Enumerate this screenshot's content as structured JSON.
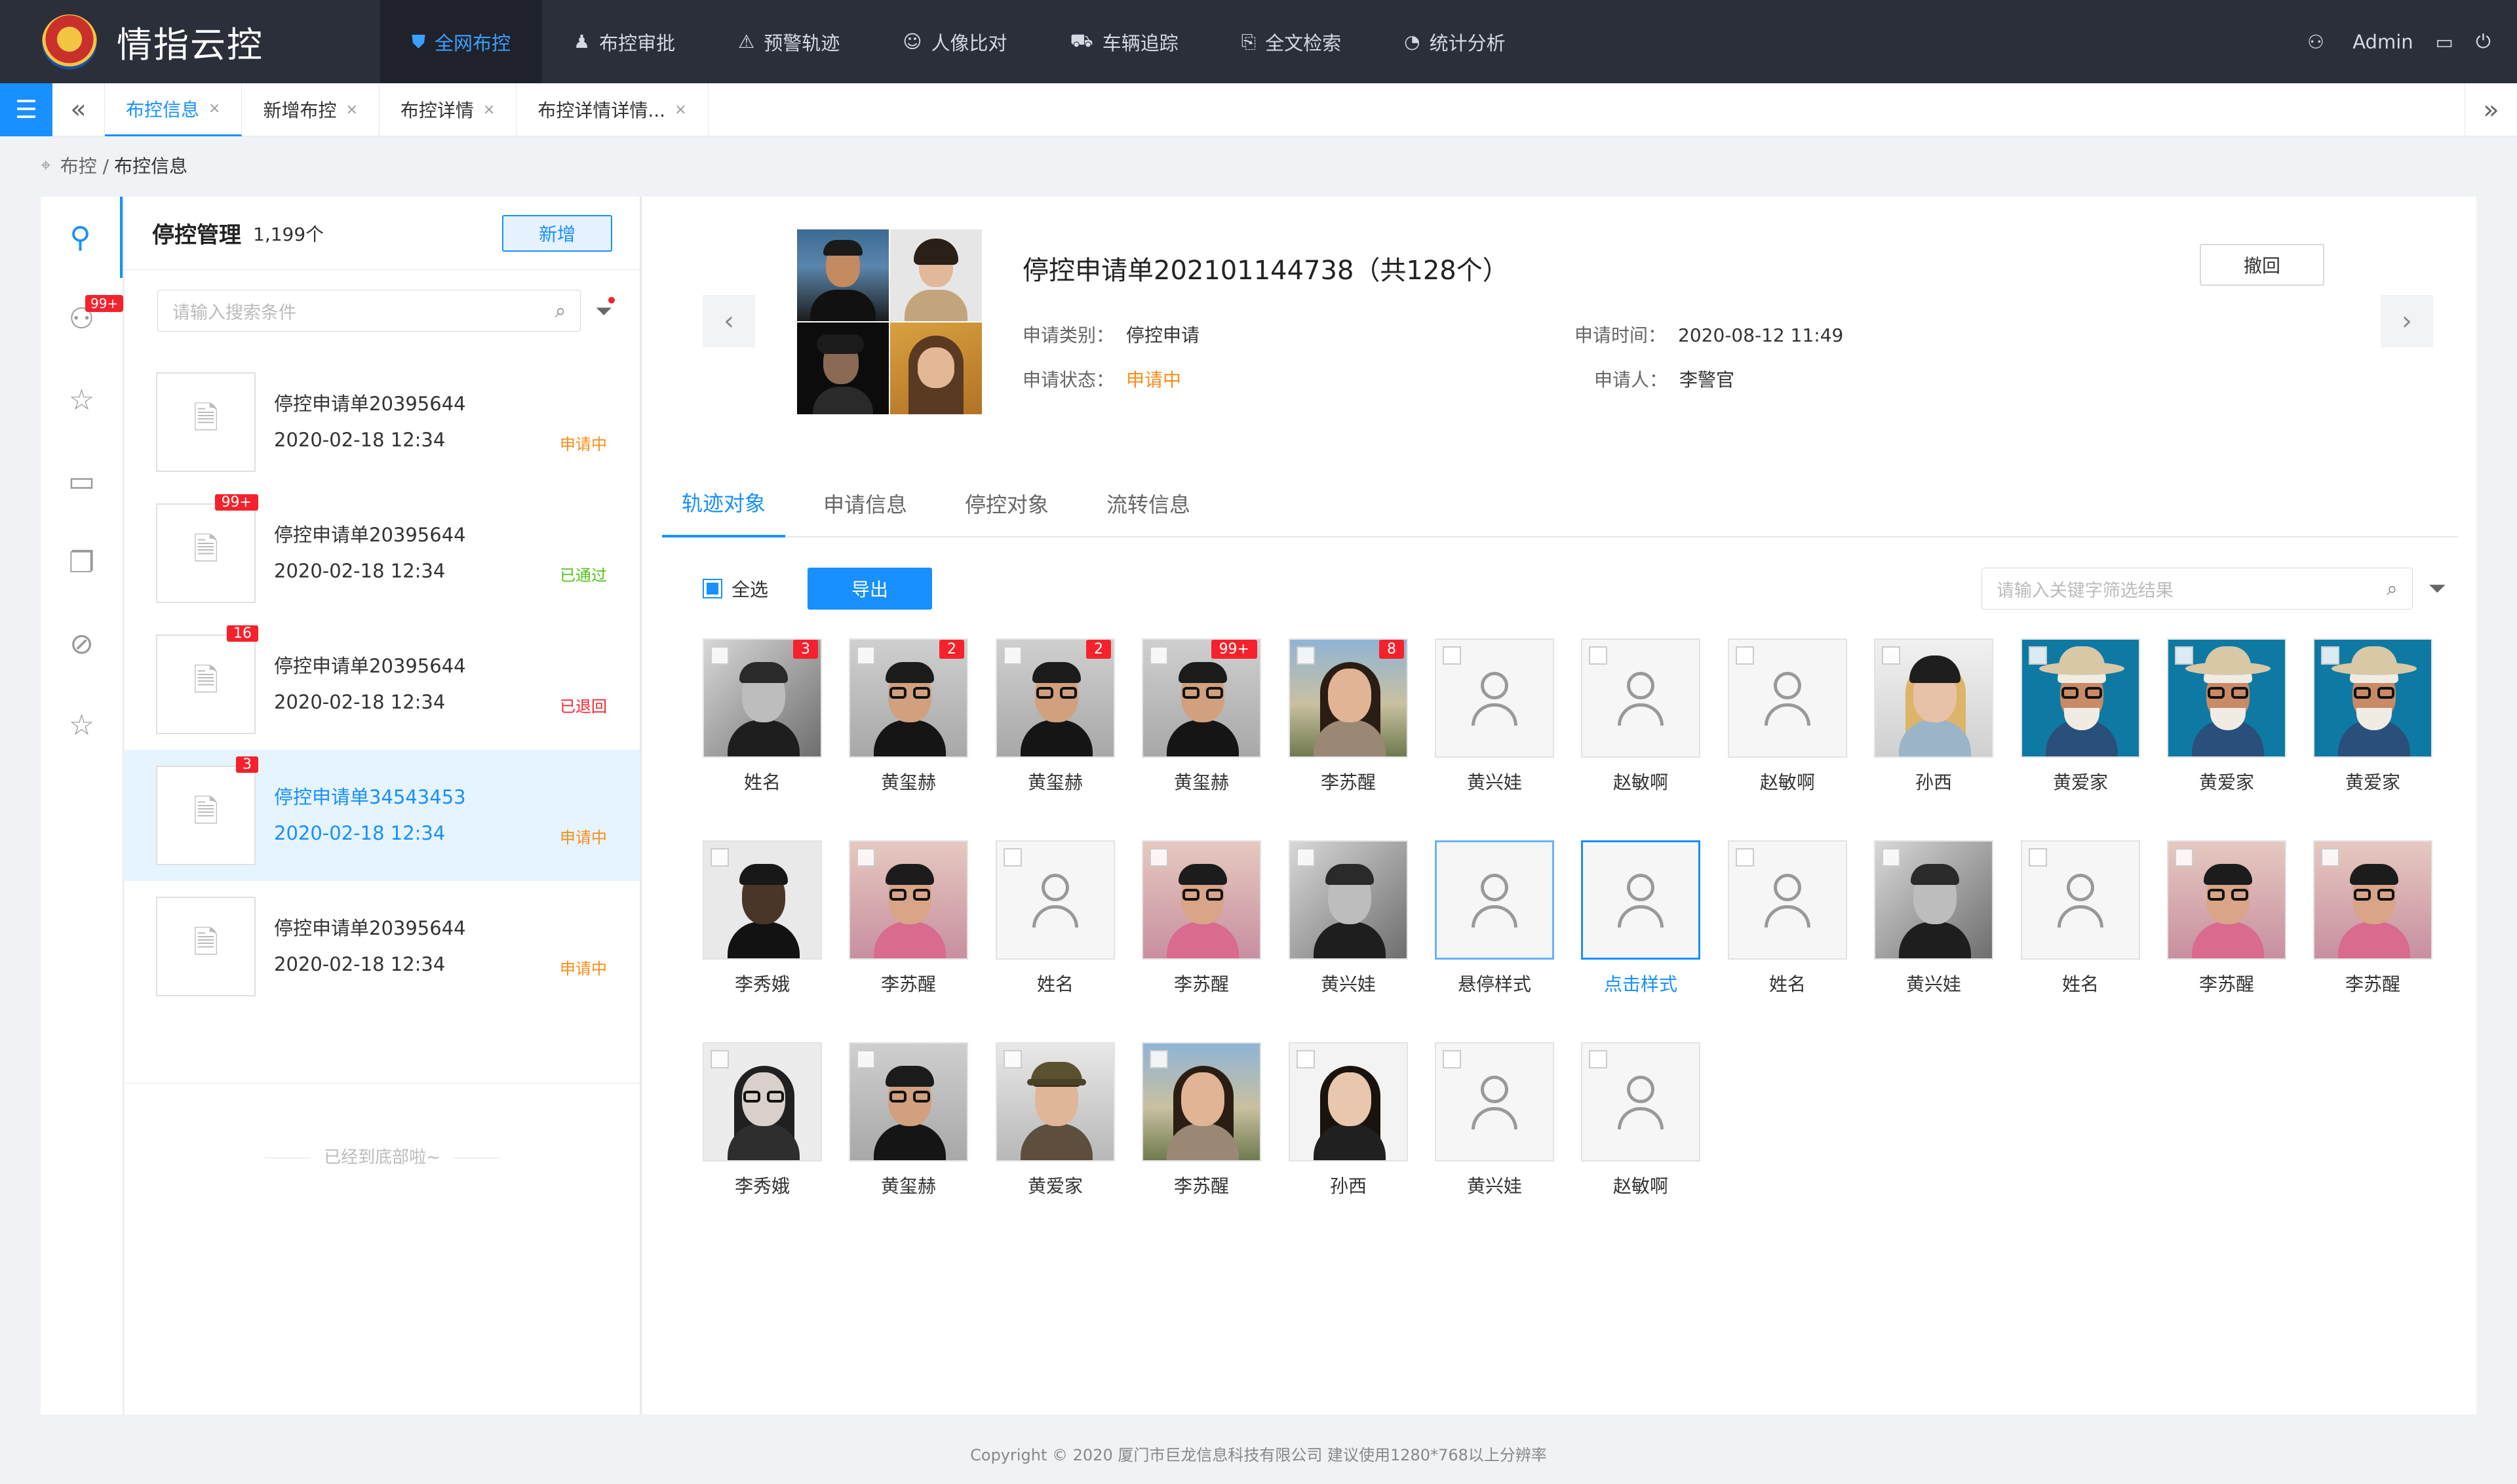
{
  "app": {
    "title": "情指云控"
  },
  "nav": [
    {
      "label": "全网布控",
      "icon": "shield-icon",
      "active": true
    },
    {
      "label": "布控审批",
      "icon": "user-icon",
      "active": false
    },
    {
      "label": "预警轨迹",
      "icon": "alarm-icon",
      "active": false
    },
    {
      "label": "人像比对",
      "icon": "face-icon",
      "active": false
    },
    {
      "label": "车辆追踪",
      "icon": "car-icon",
      "active": false
    },
    {
      "label": "全文检索",
      "icon": "doc-search-icon",
      "active": false
    },
    {
      "label": "统计分析",
      "icon": "pie-icon",
      "active": false
    }
  ],
  "user": {
    "name": "Admin"
  },
  "tabs": [
    {
      "label": "布控信息",
      "active": true
    },
    {
      "label": "新增布控",
      "active": false
    },
    {
      "label": "布控详情",
      "active": false
    },
    {
      "label": "布控详情详情...",
      "active": false
    }
  ],
  "breadcrumb": {
    "parent": "布控 /",
    "current": "布控信息"
  },
  "rail": {
    "badge": "99+"
  },
  "list": {
    "title": "停控管理",
    "count": "1,199个",
    "add_label": "新增",
    "search_placeholder": "请输入搜索条件",
    "end_text": "已经到底部啦~",
    "items": [
      {
        "title": "停控申请单20395644",
        "time": "2020-02-18  12:34",
        "status": "申请中",
        "status_type": "pending",
        "badge": ""
      },
      {
        "title": "停控申请单20395644",
        "time": "2020-02-18  12:34",
        "status": "已通过",
        "status_type": "passed",
        "badge": "99+"
      },
      {
        "title": "停控申请单20395644",
        "time": "2020-02-18  12:34",
        "status": "已退回",
        "status_type": "back",
        "badge": "16"
      },
      {
        "title": "停控申请单34543453",
        "time": "2020-02-18  12:34",
        "status": "申请中",
        "status_type": "pending",
        "badge": "3"
      },
      {
        "title": "停控申请单20395644",
        "time": "2020-02-18  12:34",
        "status": "申请中",
        "status_type": "pending",
        "badge": ""
      }
    ]
  },
  "detail": {
    "title": "停控申请单202101144738（共128个）",
    "type_label": "申请类别：",
    "type_value": "停控申请",
    "status_label": "申请状态：",
    "status_value": "申请中",
    "time_label": "申请时间：",
    "time_value": "2020-08-12   11:49",
    "applicant_label": "申请人：",
    "applicant_value": "李警官",
    "revoke_label": "撤回",
    "tabs": [
      "轨迹对象",
      "申请信息",
      "停控对象",
      "流转信息"
    ],
    "select_all": "全选",
    "export_label": "导出",
    "filter_placeholder": "请输入关键字筛选结果"
  },
  "people": [
    {
      "name": "姓名",
      "photo": "bw-man",
      "badge": "3"
    },
    {
      "name": "黄玺赫",
      "photo": "glasses-man",
      "badge": "2"
    },
    {
      "name": "黄玺赫",
      "photo": "glasses-man",
      "badge": "2"
    },
    {
      "name": "黄玺赫",
      "photo": "glasses-man",
      "badge": "99+"
    },
    {
      "name": "李苏醒",
      "photo": "woman-outdoor",
      "badge": "8"
    },
    {
      "name": "黄兴娃",
      "photo": "",
      "badge": ""
    },
    {
      "name": "赵敏啊",
      "photo": "",
      "badge": ""
    },
    {
      "name": "赵敏啊",
      "photo": "",
      "badge": ""
    },
    {
      "name": "孙西",
      "photo": "beanie-woman",
      "badge": ""
    },
    {
      "name": "黄爱家",
      "photo": "hat-man",
      "badge": ""
    },
    {
      "name": "黄爱家",
      "photo": "hat-man",
      "badge": ""
    },
    {
      "name": "黄爱家",
      "photo": "hat-man",
      "badge": ""
    },
    {
      "name": "李秀娥",
      "photo": "dark-man",
      "badge": ""
    },
    {
      "name": "李苏醒",
      "photo": "pink-man",
      "badge": ""
    },
    {
      "name": "姓名",
      "photo": "",
      "badge": ""
    },
    {
      "name": "李苏醒",
      "photo": "pink-man",
      "badge": ""
    },
    {
      "name": "黄兴娃",
      "photo": "bw-man",
      "badge": ""
    },
    {
      "name": "悬停样式",
      "photo": "",
      "badge": "",
      "state": "hover"
    },
    {
      "name": "点击样式",
      "photo": "",
      "badge": "",
      "state": "clicked"
    },
    {
      "name": "姓名",
      "photo": "",
      "badge": ""
    },
    {
      "name": "黄兴娃",
      "photo": "bw-man",
      "badge": ""
    },
    {
      "name": "姓名",
      "photo": "",
      "badge": ""
    },
    {
      "name": "李苏醒",
      "photo": "pink-man",
      "badge": ""
    },
    {
      "name": "李苏醒",
      "photo": "pink-man",
      "badge": ""
    },
    {
      "name": "李秀娥",
      "photo": "bw-woman",
      "badge": ""
    },
    {
      "name": "黄玺赫",
      "photo": "glasses-man",
      "badge": ""
    },
    {
      "name": "黄爱家",
      "photo": "cap-woman",
      "badge": ""
    },
    {
      "name": "李苏醒",
      "photo": "woman-outdoor",
      "badge": ""
    },
    {
      "name": "孙西",
      "photo": "bw-woman2",
      "badge": ""
    },
    {
      "name": "黄兴娃",
      "photo": "",
      "badge": ""
    },
    {
      "name": "赵敏啊",
      "photo": "",
      "badge": ""
    }
  ],
  "footer": "Copyright © 2020  厦门市巨龙信息科技有限公司  建议使用1280*768以上分辨率",
  "colors": {
    "primary": "#1890ff",
    "topbar": "#2b2f3a",
    "pending": "#fa8c16",
    "passed": "#52c41a",
    "back": "#f5222d"
  }
}
